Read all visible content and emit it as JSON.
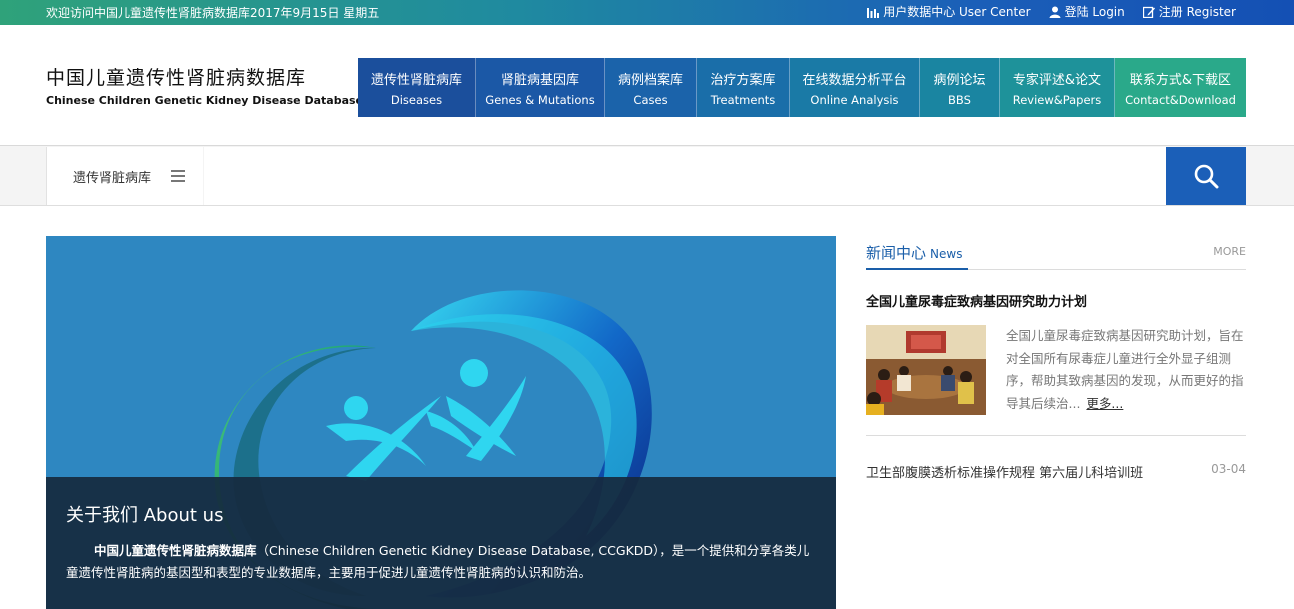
{
  "topbar": {
    "welcome": "欢迎访问中国儿童遗传性肾脏病数据库2017年9月15日 星期五",
    "user_center": "用户数据中心 User Center",
    "login": "登陆 Login",
    "register": "注册 Register"
  },
  "logo": {
    "cn": "中国儿童遗传性肾脏病数据库",
    "en": "Chinese Children Genetic Kidney Disease Database"
  },
  "nav": [
    {
      "cn": "遗传性肾脏病库",
      "en": "Diseases",
      "color": "#1b4f9c"
    },
    {
      "cn": "肾脏病基因库",
      "en": "Genes & Mutations",
      "color": "#1b58a6"
    },
    {
      "cn": "病例档案库",
      "en": "Cases",
      "color": "#1b63aa"
    },
    {
      "cn": "治疗方案库",
      "en": "Treatments",
      "color": "#1a6ea9"
    },
    {
      "cn": "在线数据分析平台",
      "en": "Online Analysis",
      "color": "#1a7aa6"
    },
    {
      "cn": "病例论坛",
      "en": "BBS",
      "color": "#1a85a1"
    },
    {
      "cn": "专家评述&论文",
      "en": "Review&Papers",
      "color": "#1e929a"
    },
    {
      "cn": "联系方式&下载区",
      "en": "Contact&Download",
      "color": "#2aa98a"
    }
  ],
  "search": {
    "category": "遗传肾脏病库",
    "value": "",
    "placeholder": ""
  },
  "about": {
    "title": "关于我们 About us",
    "name": "中国儿童遗传性肾脏病数据库",
    "text": "（Chinese Children Genetic Kidney Disease Database, CCGKDD），是一个提供和分享各类儿童遗传性肾脏病的基因型和表型的专业数据库，主要用于促进儿童遗传性肾脏病的认识和防治。"
  },
  "news": {
    "title_cn": "新闻中心",
    "title_en": "News",
    "more": "MORE",
    "featured": {
      "title": "全国儿童尿毒症致病基因研究助力计划",
      "summary": "全国儿童尿毒症致病基因研究助计划，旨在对全国所有尿毒症儿童进行全外显子组测序，帮助其致病基因的发现，从而更好的指导其后续治...",
      "more": "更多..."
    },
    "items": [
      {
        "title": "卫生部腹膜透析标准操作规程 第六届儿科培训班",
        "date": "03-04"
      }
    ]
  }
}
